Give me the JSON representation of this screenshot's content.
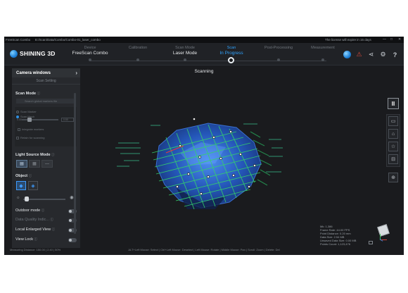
{
  "titlebar": {
    "app_name": "FreeScan Combo",
    "path": "E:/Scan/Data/Combo/Combo-01_laser_combo",
    "license_notice": "The license will expire in 15 days",
    "window_controls": [
      "—",
      "□",
      "✕"
    ]
  },
  "header": {
    "brand": "SHINING 3D",
    "steps": [
      {
        "label": "Device",
        "value": "FreeScan Combo",
        "state": "done"
      },
      {
        "label": "Calibration",
        "value": "",
        "state": "done"
      },
      {
        "label": "Scan Mode",
        "value": "Laser Mode",
        "state": "done"
      },
      {
        "label": "Scan",
        "value": "In Progress",
        "state": "active"
      },
      {
        "label": "Post-Processing",
        "value": "",
        "state": "pending"
      },
      {
        "label": "Measurement",
        "value": "",
        "state": "pending"
      }
    ],
    "icons": [
      "globe-icon",
      "alert-icon",
      "share-icon",
      "settings-icon",
      "help-icon"
    ],
    "icon_glyphs": [
      "◍",
      "⚠",
      "⋖",
      "⚙",
      "?"
    ]
  },
  "left_panel": {
    "camera_windows": "Camera windows",
    "scan_setting": "Scan Setting",
    "scan_mode_label": "Scan Mode",
    "search_placeholder": "Search global markers file",
    "radio_options": [
      "Scan Marker",
      "Scan Mesh"
    ],
    "slider_caption": "0.00",
    "spin_value": "0.50",
    "checkboxes": [
      "Integrate markers",
      "Retain for scanning"
    ],
    "light_source_label": "Light Source Mode",
    "object_label": "Object",
    "toggles": [
      {
        "label": "Outdoor mode",
        "dim": false
      },
      {
        "label": "Data Quality Indic...",
        "dim": true
      },
      {
        "label": "Local Enlarged View",
        "dim": false
      },
      {
        "label": "View Lock",
        "dim": false
      }
    ],
    "info_mark": "ⓘ"
  },
  "viewport": {
    "status": "Scanning"
  },
  "right_toolbar": {
    "pause": "II",
    "tools": [
      "▭",
      "⌂",
      "☆",
      "⊟",
      "⊕"
    ]
  },
  "stats": {
    "lines": [
      "Mk: 1,386",
      "Frame Rate: 44.00 FPS",
      "Point Distance: 0.20 mm",
      "Data Size: 2.54 MB",
      "Unsaved Data Size: 0.00 MB",
      "Points Count: 1,123,476"
    ]
  },
  "footer": {
    "left": "Measuring Distance: 150.00 | 2.40 | 50%",
    "center": "ALT+Left Mouse: Select | Ctrl+Left Mouse: Deselect | Left Mouse: Rotate | Middle Mouse: Pan | Scroll: Zoom | Delete: Del"
  },
  "colors": {
    "accent": "#2fa3ff",
    "background": "#1a1b1e",
    "panel": "#27292d",
    "scan_mesh": "#2f6fd6",
    "laser_lines": "#35d36a"
  }
}
